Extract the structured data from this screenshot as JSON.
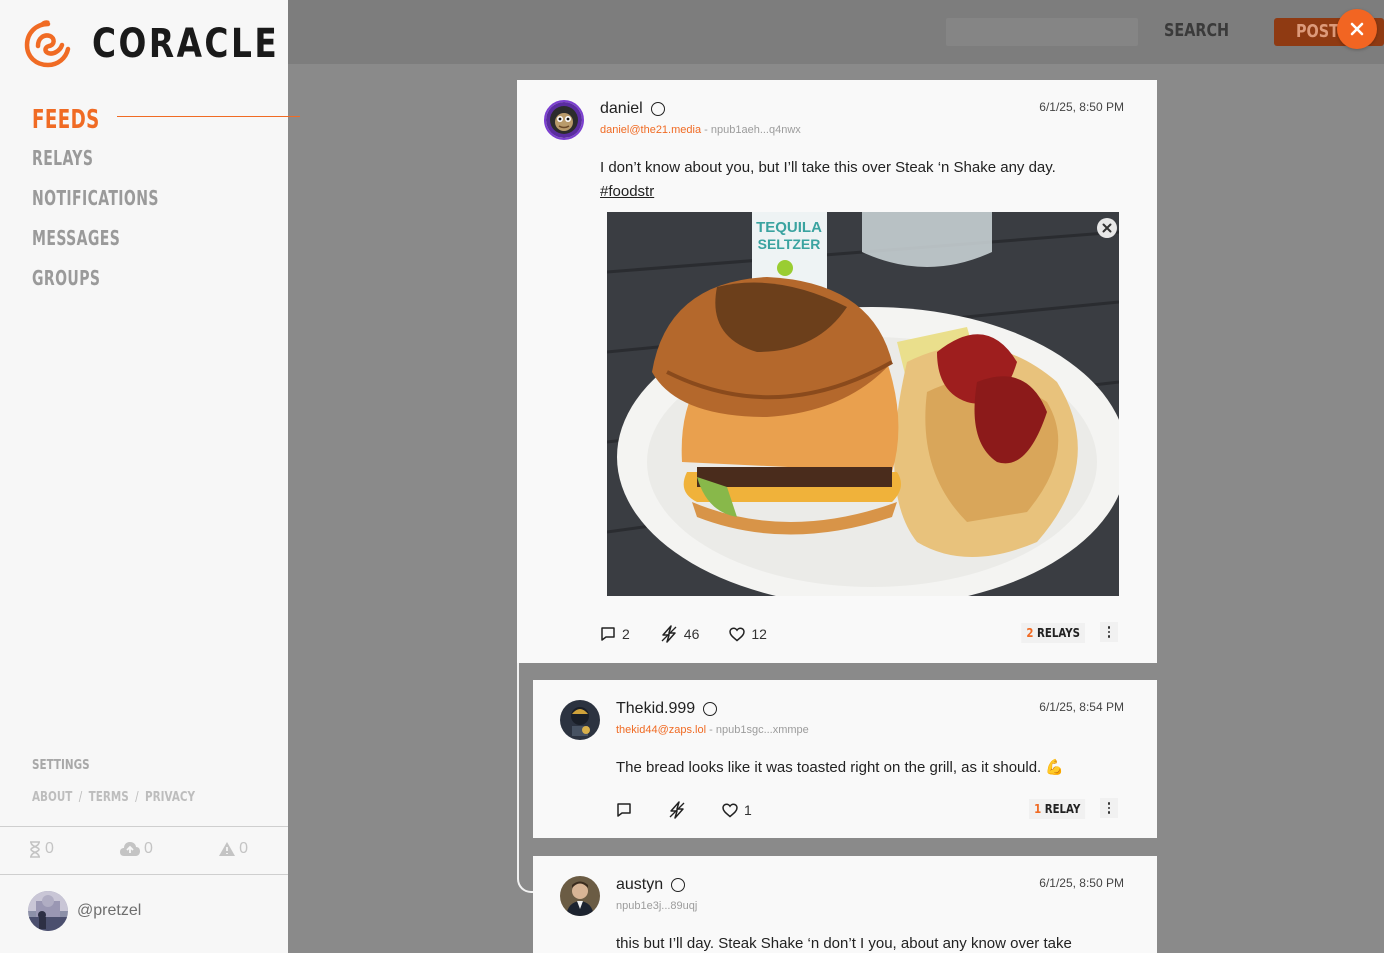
{
  "brand": {
    "name": "CORACLE",
    "accent": "#f06b24"
  },
  "nav": {
    "items": [
      {
        "label": "FEEDS",
        "active": true
      },
      {
        "label": "RELAYS"
      },
      {
        "label": "NOTIFICATIONS"
      },
      {
        "label": "MESSAGES"
      },
      {
        "label": "GROUPS"
      }
    ]
  },
  "sidebar_footer": {
    "settings": "SETTINGS",
    "about": "ABOUT",
    "terms": "TERMS",
    "privacy": "PRIVACY",
    "separator": "/",
    "stats": [
      {
        "icon": "hourglass-icon",
        "value": "0"
      },
      {
        "icon": "cloud-upload-icon",
        "value": "0"
      },
      {
        "icon": "warning-icon",
        "value": "0"
      }
    ],
    "user": {
      "handle": "@pretzel"
    }
  },
  "topbar": {
    "search_placeholder": "",
    "search_label": "SEARCH",
    "post_label": "POST +"
  },
  "feed": {
    "notes": [
      {
        "author": "daniel",
        "nip05": "daniel@the21.media",
        "npub": "npub1aeh...q4nwx",
        "time": "6/1/25, 8:50 PM",
        "text": "I don’t know about you, but I’ll take this over Steak ‘n Shake any day.",
        "hashtag": "#foodstr",
        "has_image": true,
        "image_text": [
          "TEQUILA",
          "SELTZER"
        ],
        "replies": "2",
        "zaps": "46",
        "likes": "12",
        "relay_count": "2",
        "relay_label": "RELAYS"
      },
      {
        "author": "Thekid.999",
        "nip05": "thekid44@zaps.lol",
        "npub": "npub1sgc...xmmpe",
        "time": "6/1/25, 8:54 PM",
        "text": "The bread looks like it was toasted right on the grill, as it should. 💪",
        "replies": "",
        "zaps": "",
        "likes": "1",
        "relay_count": "1",
        "relay_label": "RELAY"
      },
      {
        "author": "austyn",
        "nip05": "",
        "npub": "npub1e3j...89uqj",
        "time": "6/1/25, 8:50 PM",
        "text": "this but I’ll day. Steak Shake ‘n don’t I you, about any know over take"
      }
    ]
  }
}
